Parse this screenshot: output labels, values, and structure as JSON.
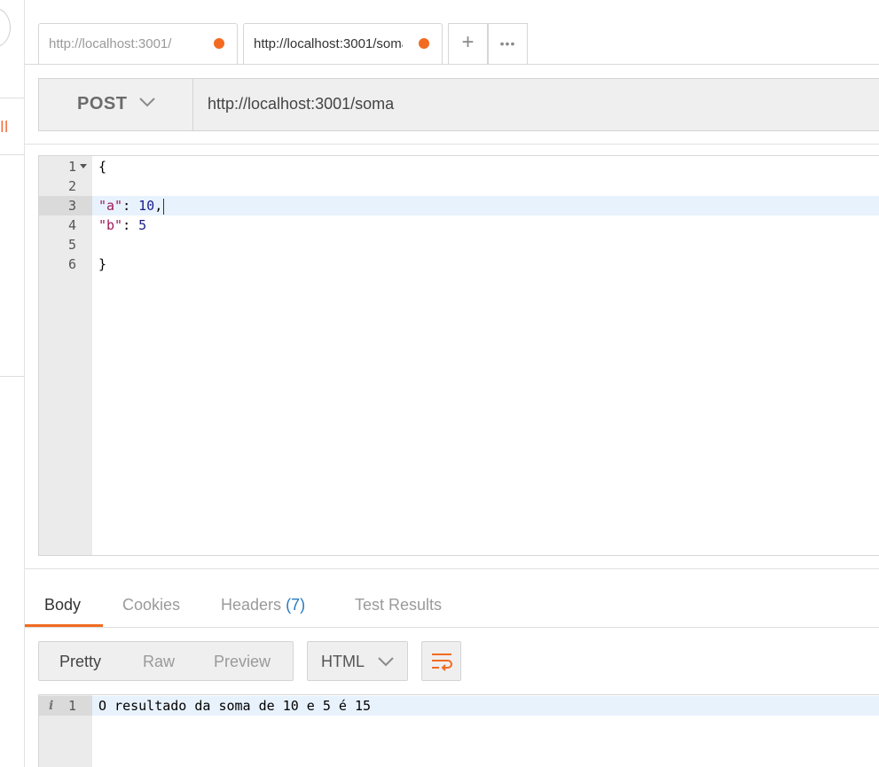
{
  "sidebar": {
    "partial_label": "ll"
  },
  "tabs": [
    {
      "label": "http://localhost:3001/"
    },
    {
      "label": "http://localhost:3001/soma"
    }
  ],
  "tab_actions": {
    "add": "+",
    "more": "•••"
  },
  "request": {
    "method": "POST",
    "url": "http://localhost:3001/soma"
  },
  "editor": {
    "line_numbers": [
      "1",
      "2",
      "3",
      "4",
      "5",
      "6"
    ],
    "lines": {
      "l1": "{",
      "l3_key": "\"a\"",
      "l3_sep": ": ",
      "l3_val": "10",
      "l3_end": ",",
      "l4_key": "\"b\"",
      "l4_sep": ": ",
      "l4_val": "5",
      "l6": "}"
    }
  },
  "response": {
    "tabs": {
      "body": "Body",
      "cookies": "Cookies",
      "headers": "Headers",
      "headers_count": "(7)",
      "tests": "Test Results"
    },
    "views": {
      "pretty": "Pretty",
      "raw": "Raw",
      "preview": "Preview"
    },
    "format": "HTML",
    "line_number": "1",
    "info_glyph": "i",
    "body_text": "O resultado da soma de 10 e 5 é 15"
  },
  "colors": {
    "accent": "#f26b21",
    "link": "#2a7bc1",
    "active_line": "#e8f2fd"
  }
}
